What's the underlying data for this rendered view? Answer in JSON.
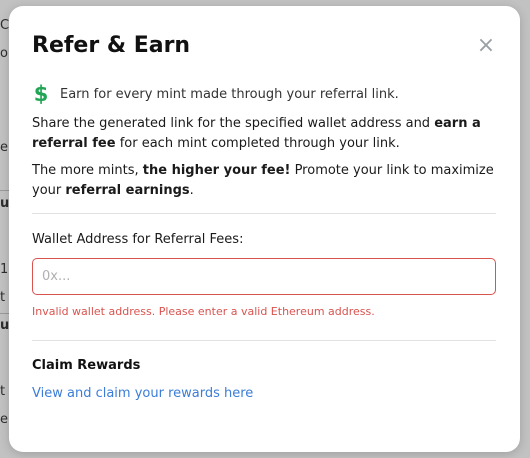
{
  "background": {
    "fragments": [
      "C",
      "o",
      "e",
      "u",
      "1",
      "t",
      "u",
      "t",
      "e"
    ]
  },
  "modal": {
    "title": "Refer & Earn",
    "close_symbol": "×",
    "earn_icon": "dollar-sign-icon",
    "earn_icon_glyph": "$",
    "earn_text": "Earn for every mint made through your referral link.",
    "share": {
      "part1": "Share the generated link for the specified wallet address and ",
      "bold1": "earn a referral fee",
      "part2": " for each mint completed through your link."
    },
    "more": {
      "part1": "The more mints, ",
      "bold1": "the higher your fee!",
      "part2": " Promote your link to maximize your ",
      "bold2": "referral earnings",
      "part3": "."
    },
    "wallet": {
      "label": "Wallet Address for Referral Fees:",
      "placeholder": "0x...",
      "value": "",
      "error": "Invalid wallet address. Please enter a valid Ethereum address."
    },
    "claim": {
      "title": "Claim Rewards",
      "link_text": "View and claim your rewards here"
    }
  },
  "colors": {
    "accent_green": "#22a655",
    "error_red": "#d9534f",
    "link_blue": "#3b7dd8"
  }
}
